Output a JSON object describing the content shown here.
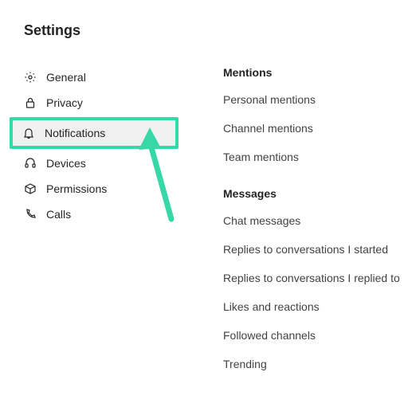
{
  "title": "Settings",
  "sidebar": {
    "items": [
      {
        "label": "General"
      },
      {
        "label": "Privacy"
      },
      {
        "label": "Notifications"
      },
      {
        "label": "Devices"
      },
      {
        "label": "Permissions"
      },
      {
        "label": "Calls"
      }
    ]
  },
  "main": {
    "sections": [
      {
        "header": "Mentions",
        "rows": [
          "Personal mentions",
          "Channel mentions",
          "Team mentions"
        ]
      },
      {
        "header": "Messages",
        "rows": [
          "Chat messages",
          "Replies to conversations I started",
          "Replies to conversations I replied to",
          "Likes and reactions",
          "Followed channels",
          "Trending"
        ]
      }
    ]
  },
  "annotation": {
    "arrow_color": "#37d8a8"
  }
}
